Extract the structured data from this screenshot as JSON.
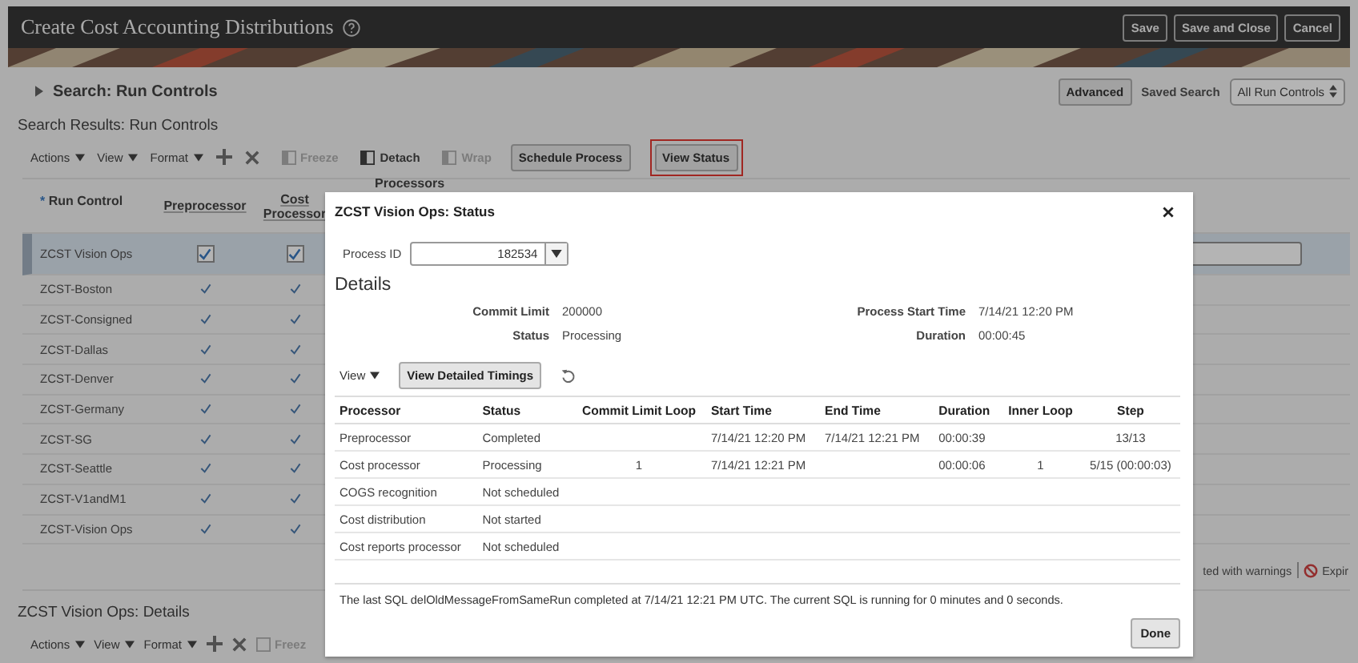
{
  "header": {
    "title": "Create Cost Accounting Distributions",
    "buttons": [
      "Save",
      "Save and Close",
      "Cancel"
    ]
  },
  "search": {
    "title": "Search: Run Controls",
    "advanced": "Advanced",
    "saved_search_label": "Saved Search",
    "saved_search_value": "All Run Controls"
  },
  "results": {
    "title": "Search Results: Run Controls",
    "toolbar": [
      {
        "kind": "menu",
        "label": "Actions"
      },
      {
        "kind": "menu",
        "label": "View"
      },
      {
        "kind": "menu",
        "label": "Format"
      },
      {
        "kind": "add"
      },
      {
        "kind": "delete"
      },
      {
        "kind": "freeze",
        "label": "Freeze",
        "disabled": true
      },
      {
        "kind": "detach",
        "label": "Detach",
        "disabled": false
      },
      {
        "kind": "wrap",
        "label": "Wrap",
        "disabled": true
      },
      {
        "kind": "button",
        "label": "Schedule Process",
        "highlighted": false
      },
      {
        "kind": "button",
        "label": "View Status",
        "highlighted": true
      }
    ],
    "required_mark": "*",
    "columns": [
      "Run Control",
      "Preprocessor",
      "Cost Processor",
      "Processors"
    ],
    "rows": [
      {
        "name": "ZCST Vision Ops",
        "preprocessor": true,
        "cost_processor": true,
        "selected": true
      },
      {
        "name": "ZCST-Boston",
        "preprocessor": true,
        "cost_processor": true,
        "selected": false
      },
      {
        "name": "ZCST-Consigned",
        "preprocessor": true,
        "cost_processor": true,
        "selected": false
      },
      {
        "name": "ZCST-Dallas",
        "preprocessor": true,
        "cost_processor": true,
        "selected": false
      },
      {
        "name": "ZCST-Denver",
        "preprocessor": true,
        "cost_processor": true,
        "selected": false
      },
      {
        "name": "ZCST-Germany",
        "preprocessor": true,
        "cost_processor": true,
        "selected": false
      },
      {
        "name": "ZCST-SG",
        "preprocessor": true,
        "cost_processor": true,
        "selected": false
      },
      {
        "name": "ZCST-Seattle",
        "preprocessor": true,
        "cost_processor": true,
        "selected": false
      },
      {
        "name": "ZCST-V1andM1",
        "preprocessor": true,
        "cost_processor": true,
        "selected": false
      },
      {
        "name": "ZCST-Vision Ops",
        "preprocessor": true,
        "cost_processor": true,
        "selected": false
      }
    ],
    "legend": [
      "ted with warnings",
      "Expir"
    ]
  },
  "details": {
    "title": "ZCST Vision Ops: Details",
    "toolbar": [
      {
        "kind": "menu",
        "label": "Actions"
      },
      {
        "kind": "menu",
        "label": "View"
      },
      {
        "kind": "menu",
        "label": "Format"
      },
      {
        "kind": "add"
      },
      {
        "kind": "delete"
      },
      {
        "kind": "freeze",
        "label": "Freez",
        "disabled": true
      }
    ]
  },
  "dialog": {
    "title": "ZCST Vision Ops: Status",
    "process_id_label": "Process ID",
    "process_id": "182534",
    "section": "Details",
    "fields_left": [
      {
        "label": "Commit Limit",
        "value": "200000"
      },
      {
        "label": "Status",
        "value": "Processing"
      }
    ],
    "fields_right": [
      {
        "label": "Process Start Time",
        "value": "7/14/21 12:20 PM"
      },
      {
        "label": "Duration",
        "value": "00:00:45"
      }
    ],
    "view_menu": "View",
    "timings_button": "View Detailed Timings",
    "columns": [
      "Processor",
      "Status",
      "Commit Limit Loop",
      "Start Time",
      "End Time",
      "Duration",
      "Inner Loop",
      "Step"
    ],
    "rows": [
      [
        "Preprocessor",
        "Completed",
        "",
        "7/14/21 12:20 PM",
        "7/14/21 12:21 PM",
        "00:00:39",
        "",
        "13/13"
      ],
      [
        "Cost processor",
        "Processing",
        "1",
        "7/14/21 12:21 PM",
        "",
        "00:00:06",
        "1",
        "5/15 (00:00:03)"
      ],
      [
        "COGS recognition",
        "Not scheduled",
        "",
        "",
        "",
        "",
        "",
        ""
      ],
      [
        "Cost distribution",
        "Not started",
        "",
        "",
        "",
        "",
        "",
        ""
      ],
      [
        "Cost reports processor",
        "Not scheduled",
        "",
        "",
        "",
        "",
        "",
        ""
      ]
    ],
    "message": "The last SQL delOldMessageFromSameRun completed at 7/14/21 12:21 PM UTC. The current SQL is running for 0 minutes and 0 seconds.",
    "done": "Done"
  }
}
